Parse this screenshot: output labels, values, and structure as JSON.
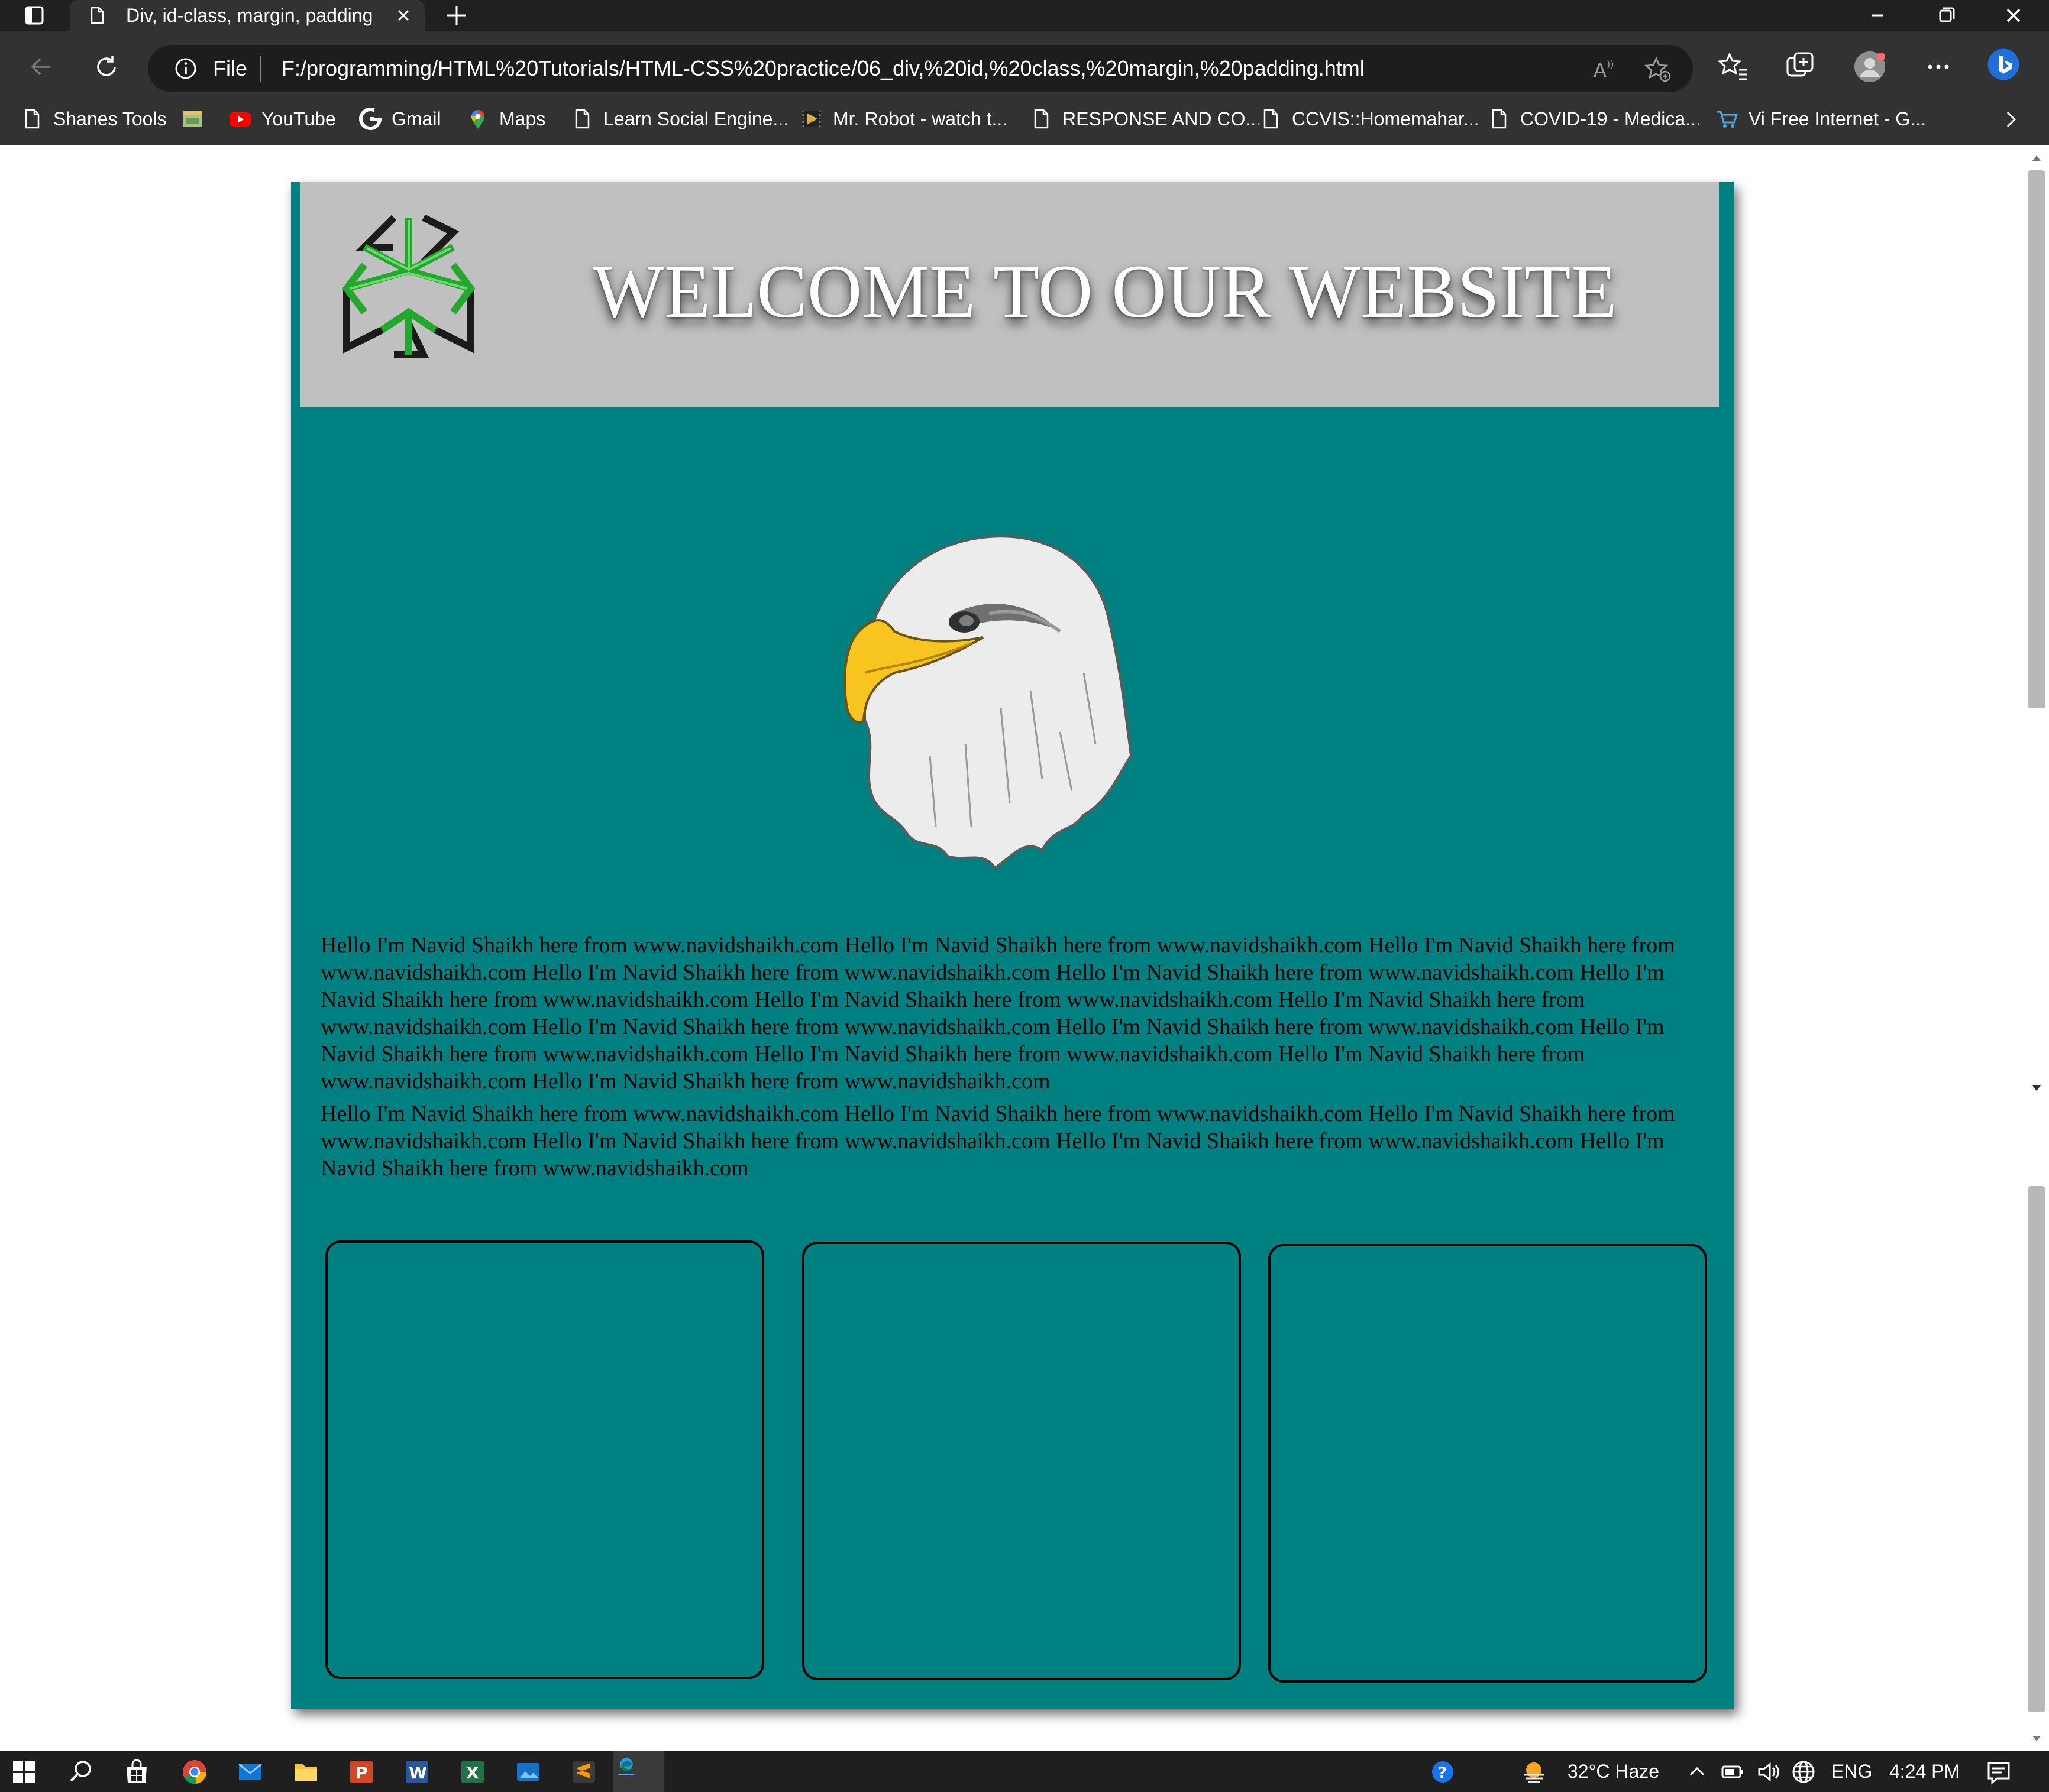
{
  "browser": {
    "tab_title": "Div, id-class, margin, padding",
    "scheme_label": "File",
    "url": "F:/programming/HTML%20Tutorials/HTML-CSS%20practice/06_div,%20id,%20class,%20margin,%20padding.html"
  },
  "bookmarks": [
    {
      "label": "Shanes Tools",
      "icon": "page-icon"
    },
    {
      "label": "",
      "icon": "image-icon"
    },
    {
      "label": "YouTube",
      "icon": "youtube-icon"
    },
    {
      "label": "Gmail",
      "icon": "google-icon"
    },
    {
      "label": "Maps",
      "icon": "maps-icon"
    },
    {
      "label": "Learn Social Engine...",
      "icon": "page-icon"
    },
    {
      "label": "Mr. Robot - watch t...",
      "icon": "video-icon"
    },
    {
      "label": "RESPONSE AND CO...",
      "icon": "page-icon"
    },
    {
      "label": "CCVIS::Homemahar...",
      "icon": "page-icon"
    },
    {
      "label": "COVID-19 - Medica...",
      "icon": "page-icon"
    },
    {
      "label": "Vi Free Internet - G...",
      "icon": "cart-icon"
    }
  ],
  "page": {
    "header_title": "WELCOME TO OUR WEBSITE",
    "paragraphs": [
      "Hello I'm Navid Shaikh here from www.navidshaikh.com Hello I'm Navid Shaikh here from www.navidshaikh.com Hello I'm Navid Shaikh here from www.navidshaikh.com Hello I'm Navid Shaikh here from www.navidshaikh.com Hello I'm Navid Shaikh here from www.navidshaikh.com Hello I'm Navid Shaikh here from www.navidshaikh.com Hello I'm Navid Shaikh here from www.navidshaikh.com Hello I'm Navid Shaikh here from www.navidshaikh.com Hello I'm Navid Shaikh here from www.navidshaikh.com Hello I'm Navid Shaikh here from www.navidshaikh.com Hello I'm Navid Shaikh here from www.navidshaikh.com Hello I'm Navid Shaikh here from www.navidshaikh.com Hello I'm Navid Shaikh here from www.navidshaikh.com Hello I'm Navid Shaikh here from www.navidshaikh.com",
      "Hello I'm Navid Shaikh here from www.navidshaikh.com Hello I'm Navid Shaikh here from www.navidshaikh.com Hello I'm Navid Shaikh here from www.navidshaikh.com Hello I'm Navid Shaikh here from www.navidshaikh.com Hello I'm Navid Shaikh here from www.navidshaikh.com Hello I'm Navid Shaikh here from www.navidshaikh.com"
    ],
    "colors": {
      "container_bg": "#008080",
      "header_bg": "#c0c0c0",
      "title_color": "#ffffff"
    }
  },
  "taskbar": {
    "weather": "32°C  Haze",
    "language": "ENG",
    "time": "4:24 PM"
  }
}
